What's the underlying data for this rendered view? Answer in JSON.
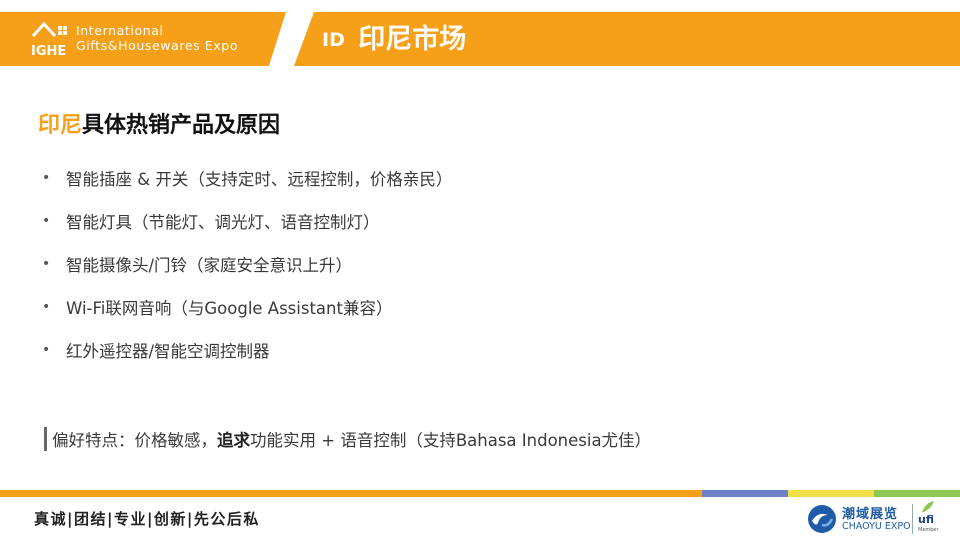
{
  "header": {
    "logo_abbr": "IGHE",
    "logo_line1": "International",
    "logo_line2": "Gifts&Housewares Expo",
    "title_code": "ID",
    "title": "印尼市场",
    "color": "#f6a01a"
  },
  "section": {
    "title_accent": "印尼",
    "title_rest": "具体热销产品及原因"
  },
  "bullets": [
    {
      "dot": "•",
      "text": "智能插座 & 开关（支持定时、远程控制，价格亲民）"
    },
    {
      "dot": "•",
      "text": "智能灯具（节能灯、调光灯、语音控制灯）"
    },
    {
      "dot": "•",
      "text": "智能摄像头/门铃（家庭安全意识上升）"
    },
    {
      "dot": "•",
      "text": "Wi-Fi联网音响（与Google Assistant兼容）"
    },
    {
      "dot": "•",
      "text": "红外遥控器/智能空调控制器"
    }
  ],
  "preference": {
    "lead": "偏好特点：价格敏感，",
    "emphasis": "追求",
    "rest": "功能实用 + 语音控制（支持Bahasa Indonesia尤佳）"
  },
  "footer": {
    "slogan": "真诚|团结|专业|创新|先公后私",
    "brand_cn": "潮域展览",
    "brand_en": "CHAOYU EXPO",
    "ufi": "ufi",
    "ufi_sub": "Member",
    "stripe_colors": [
      "#f6a01a",
      "#6b82c8",
      "#f2e04a",
      "#8ec853"
    ]
  }
}
